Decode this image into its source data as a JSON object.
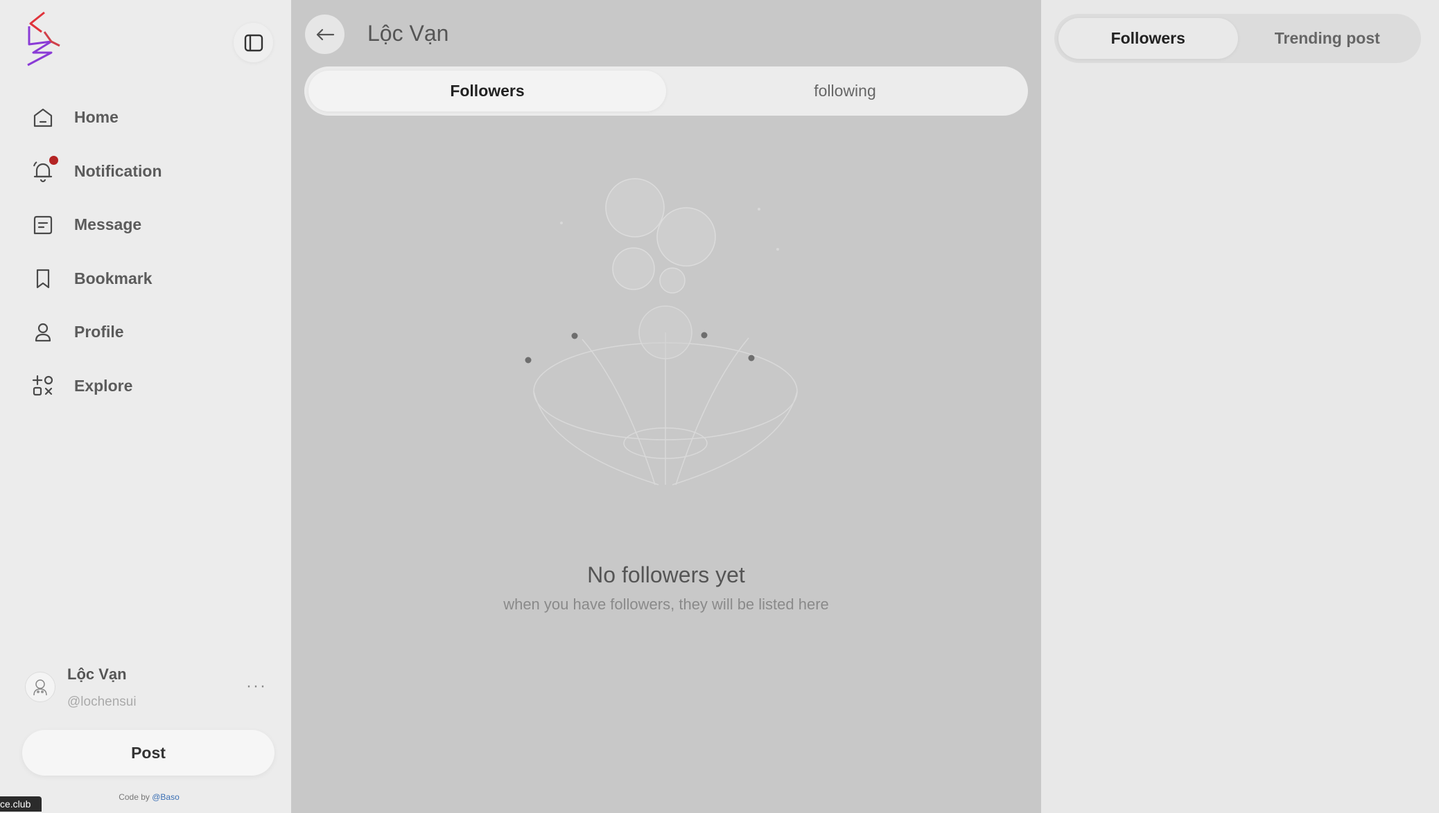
{
  "sidebar": {
    "nav": [
      {
        "label": "Home",
        "icon": "home-icon"
      },
      {
        "label": "Notification",
        "icon": "bell-icon",
        "has_badge": true
      },
      {
        "label": "Message",
        "icon": "message-icon"
      },
      {
        "label": "Bookmark",
        "icon": "bookmark-icon"
      },
      {
        "label": "Profile",
        "icon": "user-icon"
      },
      {
        "label": "Explore",
        "icon": "explore-icon"
      }
    ],
    "user": {
      "name": "Lộc Vạn",
      "handle": "@lochensui"
    },
    "more_label": "···",
    "post_label": "Post",
    "credit_prefix": "Code by",
    "credit_author": "@Baso",
    "corner_tag": "ce.club"
  },
  "main": {
    "title": "Lộc Vạn",
    "tabs": [
      {
        "label": "Followers",
        "active": true
      },
      {
        "label": "following",
        "active": false
      }
    ],
    "empty": {
      "title": "No followers yet",
      "subtitle": "when you have followers, they will be listed here"
    }
  },
  "right": {
    "tabs": [
      {
        "label": "Followers",
        "active": true
      },
      {
        "label": "Trending post",
        "active": false
      }
    ]
  },
  "colors": {
    "notification_badge": "#b42424",
    "logo_red": "#e0333b",
    "logo_purple": "#8a3bd6",
    "credit_link": "#3a6fb4"
  }
}
